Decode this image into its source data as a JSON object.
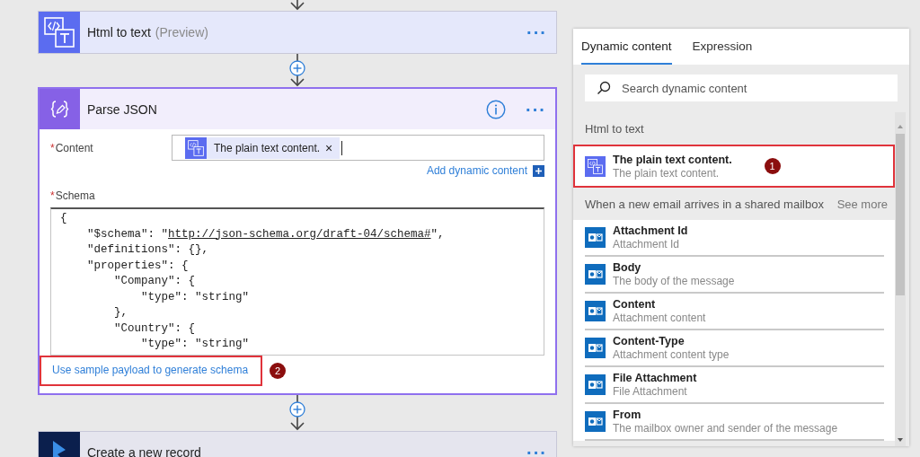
{
  "flow": {
    "html_step": {
      "title": "Html to text",
      "tag": "(Preview)",
      "menu": "···"
    },
    "parse_step": {
      "title": "Parse JSON",
      "menu": "···",
      "content_field": {
        "required": "*",
        "label": "Content",
        "token": "The plain text content.",
        "token_remove": "×"
      },
      "add_dynamic": {
        "label": "Add dynamic content"
      },
      "schema_field": {
        "required": "*",
        "label": "Schema",
        "lines": [
          [
            {
              "kind": "plain",
              "text": "{"
            }
          ],
          [
            {
              "kind": "plain",
              "text": "    \"$schema\": \""
            },
            {
              "kind": "link",
              "text": "http://json-schema.org/draft-04/schema#"
            },
            {
              "kind": "plain",
              "text": "\","
            }
          ],
          [
            {
              "kind": "plain",
              "text": "    \"definitions\": {},"
            }
          ],
          [
            {
              "kind": "plain",
              "text": "    \"properties\": {"
            }
          ],
          [
            {
              "kind": "plain",
              "text": "        \"Company\": {"
            }
          ],
          [
            {
              "kind": "plain",
              "text": "            \"type\": \"string\""
            }
          ],
          [
            {
              "kind": "plain",
              "text": "        },"
            }
          ],
          [
            {
              "kind": "plain",
              "text": "        \"Country\": {"
            }
          ],
          [
            {
              "kind": "plain",
              "text": "            \"type\": \"string\""
            }
          ]
        ]
      },
      "sample_link": {
        "label": "Use sample payload to generate schema",
        "highlighted": true,
        "badge": "2"
      }
    },
    "record_step": {
      "title": "Create a new record",
      "menu": "···"
    }
  },
  "dynamic_panel": {
    "tabs": [
      {
        "label": "Dynamic content",
        "selected": true
      },
      {
        "label": "Expression",
        "selected": false
      }
    ],
    "search": {
      "placeholder": "Search dynamic content"
    },
    "sections": [
      {
        "title": "Html to text",
        "items": [
          {
            "kind": "html",
            "title": "The plain text content.",
            "description": "The plain text content.",
            "highlighted": true,
            "badge": "1"
          }
        ]
      },
      {
        "title": "When a new email arrives in a shared mailbox",
        "see_more": "See more",
        "items": [
          {
            "kind": "outlook",
            "title": "Attachment Id",
            "description": "Attachment Id",
            "highlighted": false
          },
          {
            "kind": "outlook",
            "title": "Body",
            "description": "The body of the message",
            "highlighted": false
          },
          {
            "kind": "outlook",
            "title": "Content",
            "description": "Attachment content",
            "highlighted": false
          },
          {
            "kind": "outlook",
            "title": "Content-Type",
            "description": "Attachment content type",
            "highlighted": false
          },
          {
            "kind": "outlook",
            "title": "File Attachment",
            "description": "File Attachment",
            "highlighted": false
          },
          {
            "kind": "outlook",
            "title": "From",
            "description": "The mailbox owner and sender of the message",
            "highlighted": false
          }
        ]
      }
    ]
  }
}
